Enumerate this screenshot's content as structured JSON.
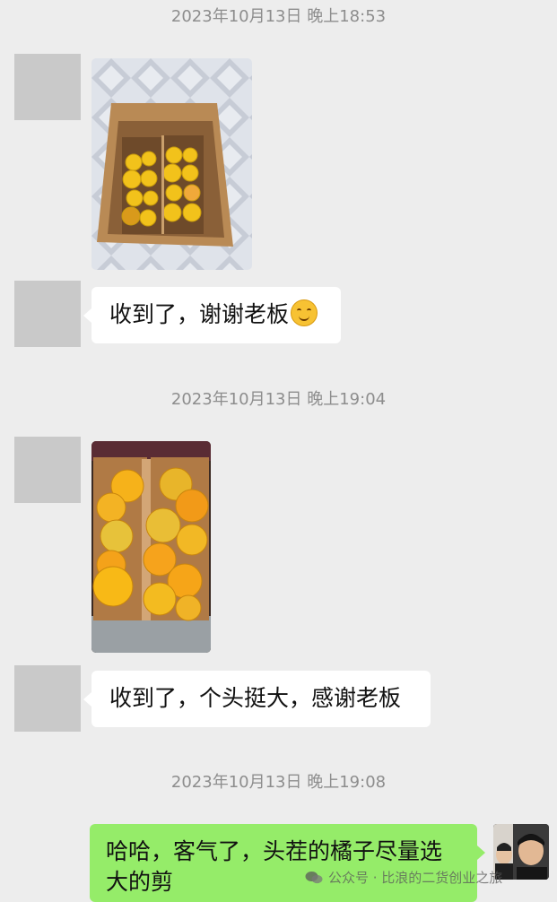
{
  "timestamps": [
    "2023年10月13日 晚上18:53",
    "2023年10月13日 晚上19:04",
    "2023年10月13日 晚上19:08"
  ],
  "messages": {
    "msg1": "收到了，谢谢老板",
    "msg2": "收到了，个头挺大，感谢老板",
    "msg3": "哈哈，客气了，头茬的橘子尽量选大的剪"
  },
  "emoji": "smile-emoji",
  "watermark": "公众号 · 比浪的二货创业之旅",
  "colors": {
    "background": "#ededed",
    "incoming_bubble": "#ffffff",
    "outgoing_bubble": "#95ec69",
    "timestamp": "#8d8d8d"
  }
}
